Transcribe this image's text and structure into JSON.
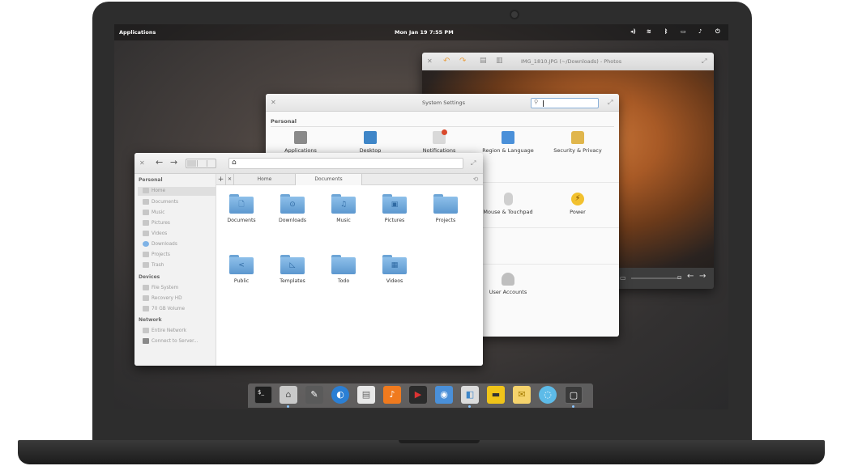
{
  "panel": {
    "applications": "Applications",
    "date": "Mon Jan 19",
    "time": "7:55 PM",
    "indicators": [
      "volume-icon",
      "wifi-icon",
      "bluetooth-icon",
      "battery-icon",
      "notification-icon",
      "power-icon"
    ]
  },
  "photos": {
    "title": "IMG_1810.JPG (~/Downloads) - Photos"
  },
  "settings": {
    "title": "System Settings",
    "search_value": "",
    "section_personal": "Personal",
    "items": [
      {
        "label": "Applications",
        "icon": "applications-icon",
        "color": "#8a8a8a"
      },
      {
        "label": "Desktop",
        "icon": "desktop-icon",
        "color": "#3f86c8"
      },
      {
        "label": "Notifications",
        "icon": "notifications-icon",
        "color": "#d9d9d9"
      },
      {
        "label": "Region & Language",
        "icon": "region-language-icon",
        "color": "#4a90d9"
      },
      {
        "label": "Security & Privacy",
        "icon": "lock-icon",
        "color": "#e0b64c"
      },
      {
        "label": "Mouse & Touchpad",
        "icon": "mouse-icon",
        "color": "#cfcfcf"
      },
      {
        "label": "Power",
        "icon": "power-lightning-icon",
        "color": "#f2c12e"
      },
      {
        "label": "User Accounts",
        "icon": "user-accounts-icon",
        "color": "#bfbfbf"
      }
    ]
  },
  "files": {
    "sidebar": {
      "personal_header": "Personal",
      "personal": [
        "Home",
        "Documents",
        "Music",
        "Pictures",
        "Videos",
        "Downloads",
        "Projects",
        "Trash"
      ],
      "devices_header": "Devices",
      "devices": [
        "File System",
        "Recovery HD",
        "70 GB Volume"
      ],
      "network_header": "Network",
      "network": [
        "Entire Network",
        "Connect to Server..."
      ]
    },
    "tabs": [
      "Home",
      "Documents"
    ],
    "folders": [
      {
        "label": "Documents",
        "glyph": "🗋"
      },
      {
        "label": "Downloads",
        "glyph": "⊙"
      },
      {
        "label": "Music",
        "glyph": "♫"
      },
      {
        "label": "Pictures",
        "glyph": "▣"
      },
      {
        "label": "Projects",
        "glyph": ""
      },
      {
        "label": "Public",
        "glyph": "<"
      },
      {
        "label": "Templates",
        "glyph": "◺"
      },
      {
        "label": "Todo",
        "glyph": ""
      },
      {
        "label": "Videos",
        "glyph": "▦"
      }
    ]
  },
  "dock": {
    "apps": [
      {
        "name": "terminal",
        "glyph": "$_",
        "color": "#1f1f1f"
      },
      {
        "name": "files",
        "glyph": "⌂",
        "color": "#c9c9c9"
      },
      {
        "name": "scratch",
        "glyph": "✎",
        "color": "#5a5a5a"
      },
      {
        "name": "midori",
        "glyph": "◐",
        "color": "#2b7fd4"
      },
      {
        "name": "calendar",
        "glyph": "▤",
        "color": "#e8e8e8"
      },
      {
        "name": "music",
        "glyph": "♪",
        "color": "#f07a1e"
      },
      {
        "name": "videos",
        "glyph": "▶",
        "color": "#2b2b2b"
      },
      {
        "name": "shotwell",
        "glyph": "◉",
        "color": "#4a90d9"
      },
      {
        "name": "switchboard",
        "glyph": "◧",
        "color": "#dcdcdc"
      },
      {
        "name": "noise",
        "glyph": "▬",
        "color": "#f0c419"
      },
      {
        "name": "mail",
        "glyph": "✉",
        "color": "#f5d36c"
      },
      {
        "name": "empathy",
        "glyph": "◌",
        "color": "#5dbbe8"
      },
      {
        "name": "screenshot",
        "glyph": "▢",
        "color": "#3a3a3a"
      }
    ]
  }
}
